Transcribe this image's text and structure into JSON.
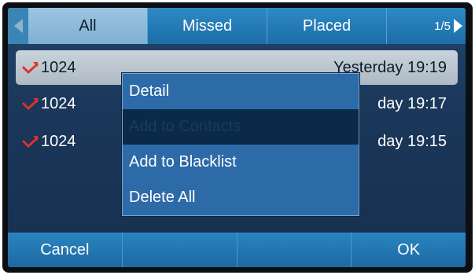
{
  "tabs": [
    {
      "label": "All",
      "active": true
    },
    {
      "label": "Missed",
      "active": false
    },
    {
      "label": "Placed",
      "active": false
    }
  ],
  "pager": {
    "label": "1/5"
  },
  "calls": [
    {
      "number": "1024",
      "time": "Yesterday 19:19",
      "type": "missed-call-icon",
      "selected": true
    },
    {
      "number": "1024",
      "time": "day 19:17",
      "type": "missed-call-icon",
      "selected": false
    },
    {
      "number": "1024",
      "time": "day 19:15",
      "type": "missed-call-icon",
      "selected": false
    }
  ],
  "menu": {
    "items": [
      {
        "label": "Detail",
        "highlighted": false
      },
      {
        "label": "Add to Contacts",
        "highlighted": true
      },
      {
        "label": "Add to Blacklist",
        "highlighted": false
      },
      {
        "label": "Delete All",
        "highlighted": false
      }
    ]
  },
  "softkeys": {
    "key1": "Cancel",
    "key2": "",
    "key3": "",
    "key4": "OK"
  },
  "colors": {
    "missed_icon": "#e0312b",
    "tab_bar": "#1d6ea8",
    "menu_bg": "#2d6aa8",
    "menu_highlight": "#0b2a4a"
  }
}
